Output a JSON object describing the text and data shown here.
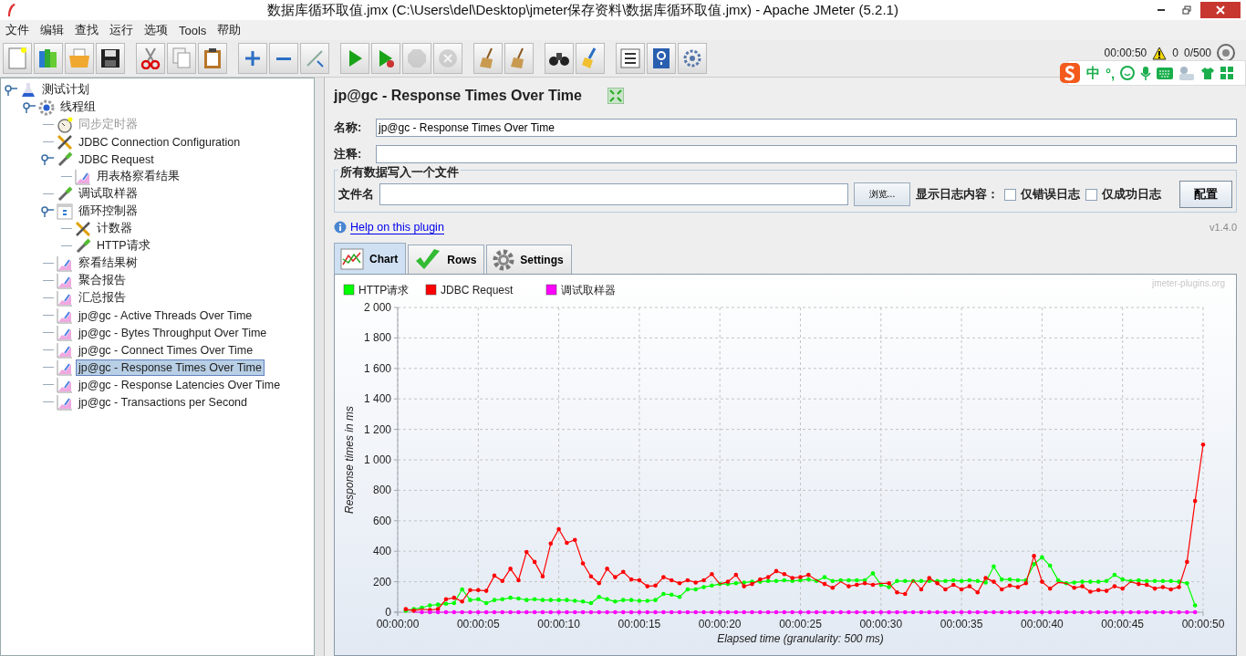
{
  "window": {
    "title": "数据库循环取值.jmx (C:\\Users\\del\\Desktop\\jmeter保存资料\\数据库循环取值.jmx) - Apache JMeter (5.2.1)"
  },
  "menu": [
    "文件",
    "编辑",
    "查找",
    "运行",
    "选项",
    "Tools",
    "帮助"
  ],
  "status": {
    "elapsed": "00:00:50",
    "warnings": "0",
    "threads": "0/500"
  },
  "ime_bar": {
    "mode": "中",
    "punct": "°,"
  },
  "tree": [
    {
      "label": "测试计划",
      "kind": "plan",
      "expanded": true,
      "disabled": false,
      "selected": false,
      "children": [
        {
          "label": "线程组",
          "kind": "thread_group",
          "expanded": true,
          "disabled": false,
          "selected": false,
          "children": [
            {
              "label": "同步定时器",
              "kind": "timer",
              "disabled": true,
              "selected": false
            },
            {
              "label": "JDBC Connection Configuration",
              "kind": "config",
              "disabled": false,
              "selected": false
            },
            {
              "label": "JDBC Request",
              "kind": "sampler",
              "expanded": true,
              "disabled": false,
              "selected": false,
              "children": [
                {
                  "label": "用表格察看结果",
                  "kind": "listener",
                  "disabled": false,
                  "selected": false
                }
              ]
            },
            {
              "label": "调试取样器",
              "kind": "sampler",
              "disabled": false,
              "selected": false
            },
            {
              "label": "循环控制器",
              "kind": "controller",
              "expanded": true,
              "disabled": false,
              "selected": false,
              "children": [
                {
                  "label": "计数器",
                  "kind": "config",
                  "disabled": false,
                  "selected": false
                },
                {
                  "label": "HTTP请求",
                  "kind": "sampler",
                  "disabled": false,
                  "selected": false
                }
              ]
            },
            {
              "label": "察看结果树",
              "kind": "listener",
              "disabled": false,
              "selected": false
            },
            {
              "label": "聚合报告",
              "kind": "listener",
              "disabled": false,
              "selected": false
            },
            {
              "label": "汇总报告",
              "kind": "listener",
              "disabled": false,
              "selected": false
            },
            {
              "label": "jp@gc - Active Threads Over Time",
              "kind": "listener",
              "disabled": false,
              "selected": false
            },
            {
              "label": "jp@gc - Bytes Throughput Over Time",
              "kind": "listener",
              "disabled": false,
              "selected": false
            },
            {
              "label": "jp@gc - Connect Times Over Time",
              "kind": "listener",
              "disabled": false,
              "selected": false
            },
            {
              "label": "jp@gc - Response Times Over Time",
              "kind": "listener",
              "disabled": false,
              "selected": true
            },
            {
              "label": "jp@gc - Response Latencies Over Time",
              "kind": "listener",
              "disabled": false,
              "selected": false
            },
            {
              "label": "jp@gc - Transactions per Second",
              "kind": "listener",
              "disabled": false,
              "selected": false
            }
          ]
        }
      ]
    }
  ],
  "panel": {
    "title": "jp@gc - Response Times Over Time",
    "name_label": "名称:",
    "name_value": "jp@gc - Response Times Over Time",
    "comment_label": "注释:",
    "file_group": {
      "legend": "所有数据写入一个文件",
      "file_label": "文件名",
      "browse": "浏览...",
      "log_label": "显示日志内容：",
      "options": [
        {
          "label": "仅错误日志",
          "checked": false
        },
        {
          "label": "仅成功日志",
          "checked": false
        }
      ],
      "configure": "配置"
    },
    "help_link": "Help on this plugin",
    "version": "v1.4.0",
    "tabs": [
      {
        "label": "Chart",
        "kind": "chart",
        "selected": true
      },
      {
        "label": "Rows",
        "kind": "rows",
        "selected": false
      },
      {
        "label": "Settings",
        "kind": "settings",
        "selected": false
      }
    ],
    "watermark": "jmeter-plugins.org",
    "chart_data": {
      "type": "line",
      "grid": true,
      "legend": true,
      "xlabel": "Elapsed time (granularity: 500 ms)",
      "ylabel": "Response times in ms",
      "x": [
        0.5,
        1,
        1.5,
        2,
        2.5,
        3,
        3.5,
        4,
        4.5,
        5,
        5.5,
        6,
        6.5,
        7,
        7.5,
        8,
        8.5,
        9,
        9.5,
        10,
        10.5,
        11,
        11.5,
        12,
        12.5,
        13,
        13.5,
        14,
        14.5,
        15,
        15.5,
        16,
        16.5,
        17,
        17.5,
        18,
        18.5,
        19,
        19.5,
        20,
        20.5,
        21,
        21.5,
        22,
        22.5,
        23,
        23.5,
        24,
        24.5,
        25,
        25.5,
        26,
        26.5,
        27,
        27.5,
        28,
        28.5,
        29,
        29.5,
        30,
        30.5,
        31,
        31.5,
        32,
        32.5,
        33,
        33.5,
        34,
        34.5,
        35,
        35.5,
        36,
        36.5,
        37,
        37.5,
        38,
        38.5,
        39,
        39.5,
        40,
        40.5,
        41,
        41.5,
        42,
        42.5,
        43,
        43.5,
        44,
        44.5,
        45,
        45.5,
        46,
        46.5,
        47,
        47.5,
        48,
        48.5,
        49,
        49.5,
        50
      ],
      "xlim": [
        0,
        50
      ],
      "ylim": [
        0,
        2000
      ],
      "xticks": [
        {
          "value": 0,
          "label": "00:00:00"
        },
        {
          "value": 5,
          "label": "00:00:05"
        },
        {
          "value": 10,
          "label": "00:00:10"
        },
        {
          "value": 15,
          "label": "00:00:15"
        },
        {
          "value": 20,
          "label": "00:00:20"
        },
        {
          "value": 25,
          "label": "00:00:25"
        },
        {
          "value": 30,
          "label": "00:00:30"
        },
        {
          "value": 35,
          "label": "00:00:35"
        },
        {
          "value": 40,
          "label": "00:00:40"
        },
        {
          "value": 45,
          "label": "00:00:45"
        },
        {
          "value": 50,
          "label": "00:00:50"
        }
      ],
      "yticks": [
        {
          "value": 0,
          "label": "0"
        },
        {
          "value": 200,
          "label": "200"
        },
        {
          "value": 400,
          "label": "400"
        },
        {
          "value": 600,
          "label": "600"
        },
        {
          "value": 800,
          "label": "800"
        },
        {
          "value": 1000,
          "label": "1 000"
        },
        {
          "value": 1200,
          "label": "1 200"
        },
        {
          "value": 1400,
          "label": "1 400"
        },
        {
          "value": 1600,
          "label": "1 600"
        },
        {
          "value": 1800,
          "label": "1 800"
        },
        {
          "value": 2000,
          "label": "2 000"
        }
      ],
      "series": [
        {
          "name": "HTTP请求",
          "color": "#00ff00",
          "values": [
            10,
            20,
            30,
            45,
            50,
            55,
            60,
            150,
            80,
            85,
            60,
            80,
            85,
            95,
            90,
            80,
            85,
            80,
            80,
            80,
            80,
            75,
            70,
            60,
            100,
            85,
            70,
            80,
            80,
            75,
            75,
            80,
            120,
            115,
            100,
            150,
            150,
            165,
            175,
            185,
            185,
            190,
            195,
            200,
            200,
            205,
            205,
            210,
            205,
            210,
            215,
            205,
            230,
            205,
            210,
            210,
            210,
            210,
            255,
            180,
            165,
            205,
            205,
            205,
            205,
            205,
            205,
            205,
            210,
            205,
            210,
            205,
            195,
            300,
            215,
            215,
            210,
            210,
            315,
            360,
            305,
            210,
            190,
            195,
            200,
            200,
            200,
            205,
            245,
            215,
            205,
            210,
            205,
            205,
            205,
            205,
            200,
            190,
            45,
            null
          ]
        },
        {
          "name": "JDBC Request",
          "color": "#ff0000",
          "values": [
            20,
            10,
            20,
            15,
            20,
            85,
            95,
            70,
            145,
            145,
            140,
            240,
            205,
            285,
            210,
            395,
            330,
            235,
            450,
            545,
            455,
            475,
            320,
            235,
            190,
            285,
            230,
            265,
            215,
            210,
            170,
            175,
            230,
            210,
            190,
            210,
            195,
            210,
            250,
            185,
            200,
            245,
            170,
            185,
            215,
            230,
            270,
            250,
            225,
            230,
            245,
            210,
            185,
            160,
            200,
            170,
            180,
            190,
            180,
            190,
            190,
            130,
            120,
            210,
            150,
            225,
            190,
            150,
            180,
            150,
            170,
            130,
            225,
            200,
            150,
            175,
            165,
            190,
            370,
            200,
            155,
            195,
            190,
            160,
            170,
            135,
            145,
            140,
            170,
            155,
            200,
            185,
            180,
            155,
            165,
            150,
            165,
            330,
            730,
            1100
          ]
        },
        {
          "name": "调试取样器",
          "color": "#ff00ff",
          "values": [
            null,
            0,
            0,
            0,
            0,
            0,
            0,
            0,
            0,
            0,
            0,
            0,
            0,
            0,
            0,
            0,
            0,
            0,
            0,
            0,
            0,
            0,
            0,
            0,
            0,
            0,
            0,
            0,
            0,
            0,
            0,
            0,
            0,
            0,
            0,
            0,
            0,
            0,
            0,
            0,
            0,
            0,
            0,
            0,
            0,
            0,
            0,
            0,
            0,
            0,
            0,
            0,
            0,
            0,
            0,
            0,
            0,
            0,
            0,
            0,
            0,
            0,
            0,
            0,
            0,
            0,
            0,
            0,
            0,
            0,
            0,
            0,
            0,
            0,
            0,
            0,
            0,
            0,
            0,
            0,
            0,
            0,
            0,
            0,
            0,
            0,
            0,
            0,
            0,
            0,
            0,
            0,
            0,
            0,
            0,
            0,
            0,
            0,
            0,
            null
          ]
        }
      ]
    }
  }
}
